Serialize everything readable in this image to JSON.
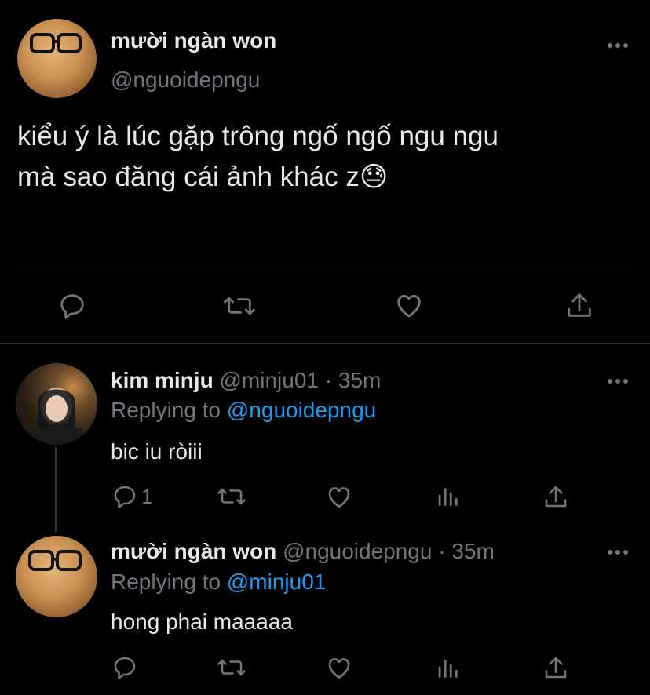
{
  "main_tweet": {
    "display_name": "mười ngàn won",
    "handle": "@nguoidepngu",
    "text_line1": "kiểu ý là lúc gặp trông ngố ngố ngu ngu",
    "text_line2": "mà sao đăng cái ảnh khác z😓",
    "more_icon": "ellipsis-icon"
  },
  "actions": [
    "reply-icon",
    "retweet-icon",
    "like-icon",
    "share-icon"
  ],
  "replies": [
    {
      "display_name": "kim minju",
      "meta": "@minju01 · 35m",
      "replying_prefix": "Replying to",
      "replying_to": "@nguoidepngu",
      "text": "bic iu ròiii",
      "reply_count": "1"
    },
    {
      "display_name": "mười ngàn won",
      "meta": "@nguoidepngu · 35m",
      "replying_prefix": "Replying to",
      "replying_to": "@minju01",
      "text": "hong phai maaaaa",
      "reply_count": ""
    }
  ],
  "colors": {
    "background": "#000000",
    "text": "#e7e9ea",
    "muted": "#71767b",
    "link": "#1d9bf0"
  }
}
